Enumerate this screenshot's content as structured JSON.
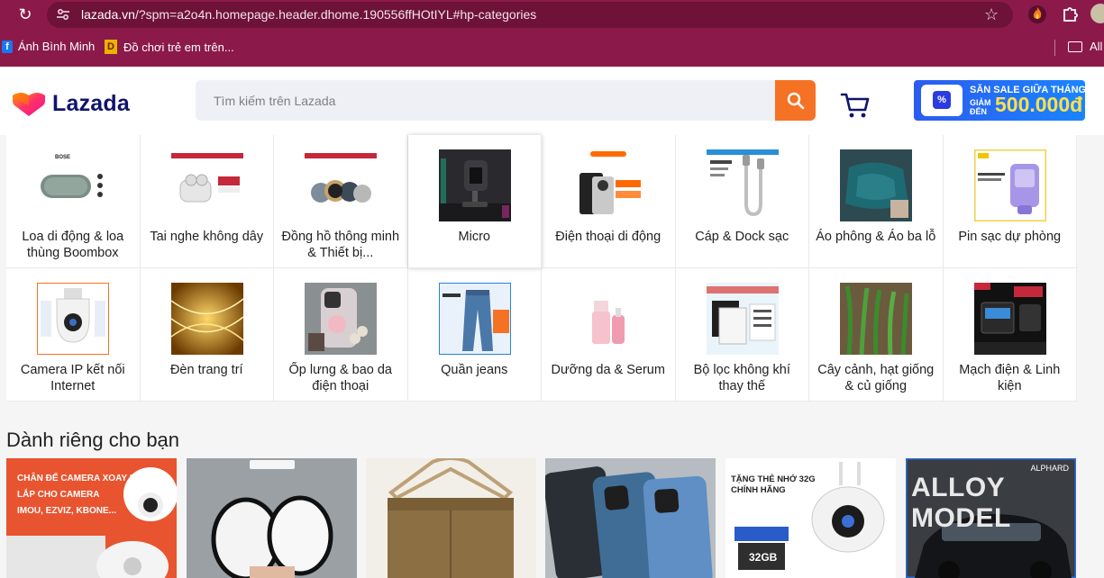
{
  "browser": {
    "url_domain": "lazada.vn",
    "url_path": "/?spm=a2o4n.homepage.header.dhome.190556ffHOtIYL#hp-categories",
    "bookmarks": [
      {
        "label": "Ánh Bình Minh"
      },
      {
        "label": "Đồ chơi trẻ em trên..."
      }
    ],
    "all_bookmarks_label": "All"
  },
  "header": {
    "logo_text": "Lazada",
    "search_placeholder": "Tìm kiếm trên Lazada",
    "promo": {
      "line1": "SĂN SALE GIỮA THÁNG",
      "line2": "GIẢM ĐẾN",
      "amount": "500.000đ"
    }
  },
  "categories": [
    {
      "label": "Loa di động & loa thùng Boombox"
    },
    {
      "label": "Tai nghe không dây"
    },
    {
      "label": "Đồng hồ thông minh & Thiết bị..."
    },
    {
      "label": "Micro"
    },
    {
      "label": "Điện thoại di động"
    },
    {
      "label": "Cáp & Dock sạc"
    },
    {
      "label": "Áo phông & Áo ba lỗ"
    },
    {
      "label": "Pin sạc dự phòng"
    },
    {
      "label": "Camera IP kết nối Internet"
    },
    {
      "label": "Đèn trang trí"
    },
    {
      "label": "Ốp lưng & bao da điện thoại"
    },
    {
      "label": "Quần jeans"
    },
    {
      "label": "Dưỡng da & Serum"
    },
    {
      "label": "Bộ lọc không khí thay thế"
    },
    {
      "label": "Cây cảnh, hạt giống & củ giống"
    },
    {
      "label": "Mạch điện & Linh kiện"
    }
  ],
  "for_you": {
    "title": "Dành riêng cho bạn",
    "cards": [
      {
        "caption": "CHÂN ĐẾ CAMERA XOAY 360\nLẮP CHO CAMERA\nIMOU, EZVIZ, KBONE..."
      },
      {
        "caption": ""
      },
      {
        "caption": ""
      },
      {
        "caption": ""
      },
      {
        "caption": "TẶNG THẺ NHỚ 32G\nCHÍNH HÃNG"
      },
      {
        "caption": "ALLOY MODEL",
        "sub": "ALPHARD"
      }
    ]
  },
  "colors": {
    "chrome": "#8b1a4a",
    "lazada_orange": "#f57224",
    "lazada_navy": "#0f146d",
    "promo_blue": "#2b5cf0"
  }
}
